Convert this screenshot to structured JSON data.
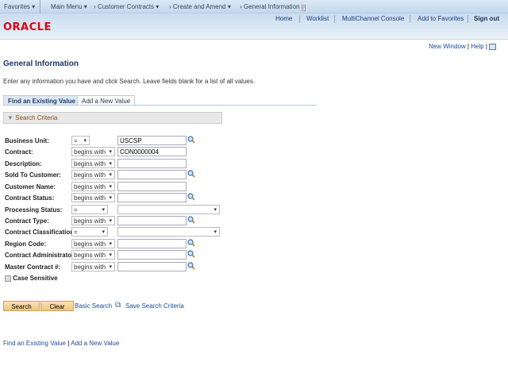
{
  "topbar": {
    "favorites": "Favorites",
    "main_menu": "Main Menu",
    "breadcrumbs": [
      "Customer Contracts",
      "Create and Amend",
      "General Information"
    ]
  },
  "header": {
    "logo": "ORACLE",
    "links": [
      "Home",
      "Worklist",
      "MultiChannel Console",
      "Add to Favorites",
      "Sign out"
    ]
  },
  "pagebar": {
    "new_window": "New Window",
    "help": "Help"
  },
  "page": {
    "title": "General Information",
    "instructions": "Enter any information you have and click Search. Leave fields blank for a list of all values."
  },
  "tabs": [
    {
      "label": "Find an Existing Value",
      "active": true
    },
    {
      "label": "Add a New Value",
      "active": false
    }
  ],
  "search_criteria": {
    "title": "Search Criteria"
  },
  "fields": [
    {
      "label": "Business Unit:",
      "operator": "=",
      "value": "USCSP",
      "lookup": true,
      "kind": "short"
    },
    {
      "label": "Contract:",
      "operator": "begins with",
      "value": "CON0000004",
      "lookup": false,
      "kind": "text"
    },
    {
      "label": "Description:",
      "operator": "begins with",
      "value": "",
      "lookup": false,
      "kind": "text"
    },
    {
      "label": "Sold To Customer:",
      "operator": "begins with",
      "value": "",
      "lookup": true,
      "kind": "text"
    },
    {
      "label": "Customer Name:",
      "operator": "begins with",
      "value": "",
      "lookup": false,
      "kind": "text"
    },
    {
      "label": "Contract Status:",
      "operator": "begins with",
      "value": "",
      "lookup": true,
      "kind": "text"
    },
    {
      "label": "Processing Status:",
      "operator": "=",
      "value": "",
      "lookup": false,
      "kind": "dropdown"
    },
    {
      "label": "Contract Type:",
      "operator": "begins with",
      "value": "",
      "lookup": true,
      "kind": "text"
    },
    {
      "label": "Contract Classification:",
      "operator": "=",
      "value": "",
      "lookup": false,
      "kind": "dropdown"
    },
    {
      "label": "Region Code:",
      "operator": "begins with",
      "value": "",
      "lookup": true,
      "kind": "text"
    },
    {
      "label": "Contract Administrator:",
      "operator": "begins with",
      "value": "",
      "lookup": true,
      "kind": "text"
    },
    {
      "label": "Master Contract #:",
      "operator": "begins with",
      "value": "",
      "lookup": true,
      "kind": "text"
    }
  ],
  "case_sensitive": {
    "label": "Case Sensitive",
    "checked": false
  },
  "buttons": {
    "search": "Search",
    "clear": "Clear",
    "basic_search": "Basic Search",
    "save_search": "Save Search Criteria"
  },
  "footer": {
    "find": "Find an Existing Value",
    "add": "Add a New Value"
  }
}
